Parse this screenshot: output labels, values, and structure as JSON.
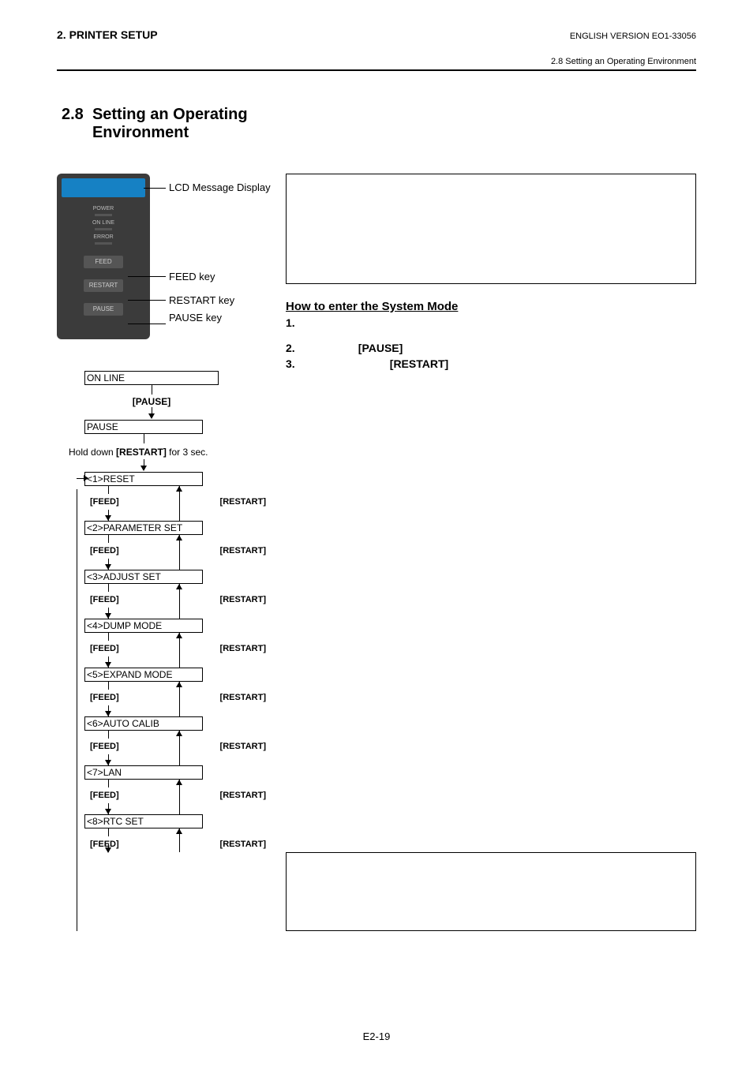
{
  "header": {
    "left": "2. PRINTER SETUP",
    "version": "ENGLISH VERSION EO1-33056",
    "subtitle": "2.8 Setting an Operating Environment"
  },
  "section": {
    "number": "2.8",
    "title": "Setting an Operating Environment"
  },
  "callouts": {
    "lcd": "LCD Message Display",
    "feed": "FEED key",
    "restart": "RESTART key",
    "pause": "PAUSE key"
  },
  "panel": {
    "power": "POWER",
    "online": "ON LINE",
    "error": "ERROR",
    "feed": "FEED",
    "restart": "RESTART",
    "pause": "PAUSE"
  },
  "howto": {
    "title": "How to enter the System Mode",
    "step1_num": "1.",
    "step2_num": "2.",
    "step2_key": "[PAUSE]",
    "step3_num": "3.",
    "step3_key": "[RESTART]"
  },
  "flow": {
    "online": "ON LINE",
    "pause_key": "[PAUSE]",
    "pause_state": "PAUSE",
    "hold_pre": "Hold down ",
    "hold_key": "[RESTART]",
    "hold_post": " for 3 sec.",
    "feed_label": "[FEED]",
    "restart_label": "[RESTART]",
    "menus": [
      "<1>RESET",
      "<2>PARAMETER SET",
      "<3>ADJUST SET",
      "<4>DUMP MODE",
      "<5>EXPAND MODE",
      "<6>AUTO CALIB",
      "<7>LAN",
      "<8>RTC SET"
    ]
  },
  "footer": "E2-19"
}
